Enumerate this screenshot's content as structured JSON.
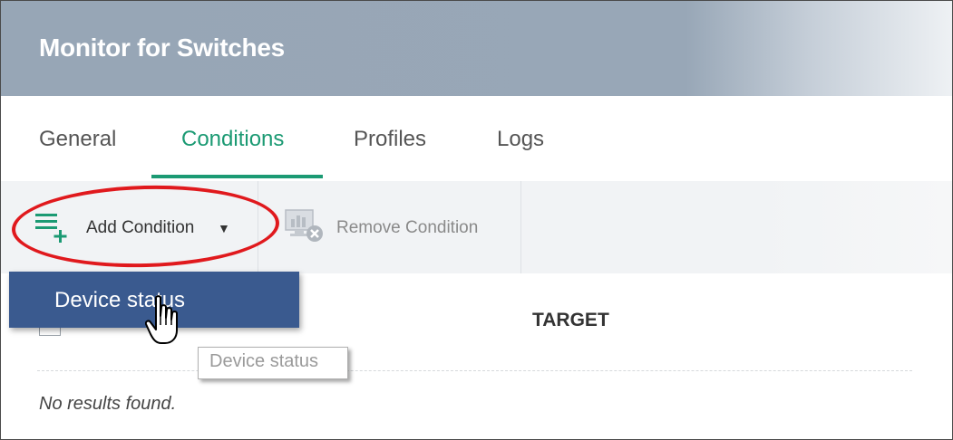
{
  "header": {
    "title": "Monitor for Switches"
  },
  "tabs": [
    {
      "label": "General"
    },
    {
      "label": "Conditions",
      "active": true
    },
    {
      "label": "Profiles"
    },
    {
      "label": "Logs"
    }
  ],
  "toolbar": {
    "add_condition_label": "Add Condition",
    "remove_condition_label": "Remove Condition"
  },
  "dropdown": {
    "items": [
      {
        "label": "Device status"
      }
    ]
  },
  "tooltip": {
    "text": "Device status"
  },
  "table": {
    "columns": [
      "TARGET"
    ],
    "empty_message": "No results found."
  },
  "colors": {
    "header_bg": "#98a7b7",
    "accent": "#1b9a73",
    "dropdown_bg": "#3a5a8f",
    "annotation": "#e0191d"
  },
  "icons": {
    "add": "add-list-icon",
    "remove": "remove-monitor-icon",
    "caret": "caret-down-icon",
    "cursor": "hand-pointer-icon"
  }
}
